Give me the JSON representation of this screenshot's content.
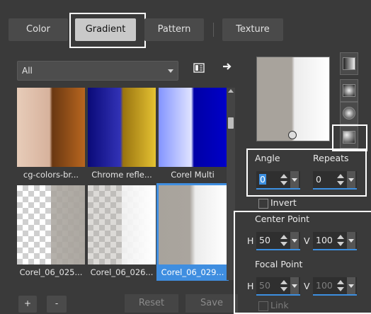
{
  "tabs": [
    {
      "label": "Color"
    },
    {
      "label": "Gradient",
      "active": true
    },
    {
      "label": "Pattern"
    },
    {
      "label": "Texture"
    }
  ],
  "filter": {
    "value": "All"
  },
  "gradients": [
    {
      "label": "cg-colors-br...",
      "colors": [
        "#e4c8b5",
        "#d8b29c",
        "#6e3b18",
        "#c06a22"
      ]
    },
    {
      "label": "Chrome refle...",
      "colors": [
        "#0a0a7a",
        "#3030b8",
        "#b28818",
        "#e0c030"
      ]
    },
    {
      "label": "Corel Multi",
      "colors": [
        "#7b8cff",
        "#d6dcff",
        "#0000a8",
        "#0000cc"
      ]
    },
    {
      "label": "Corel_06_025...",
      "colors": [
        "#a8a39c",
        "#a8a39c"
      ]
    },
    {
      "label": "Corel_06_026...",
      "colors": [
        "#a8a39c",
        "#ffffff"
      ]
    },
    {
      "label": "Corel_06_029...",
      "colors": [
        "#a8a39c",
        "#ffffff"
      ],
      "selected": true
    }
  ],
  "buttons": {
    "add": "+",
    "remove": "-",
    "reset": "Reset",
    "save": "Save"
  },
  "angle": {
    "label": "Angle",
    "value": "0"
  },
  "repeats": {
    "label": "Repeats",
    "value": "0"
  },
  "invert": {
    "label": "Invert"
  },
  "center_point": {
    "label": "Center Point",
    "h_label": "H",
    "h": "50",
    "v_label": "V",
    "v": "100"
  },
  "focal_point": {
    "label": "Focal Point",
    "h_label": "H",
    "h": "50",
    "v_label": "V",
    "v": "100"
  },
  "link": {
    "label": "Link"
  },
  "colors": {
    "accent": "#3c8fe0",
    "selected_cell": "#3f8ee0"
  }
}
